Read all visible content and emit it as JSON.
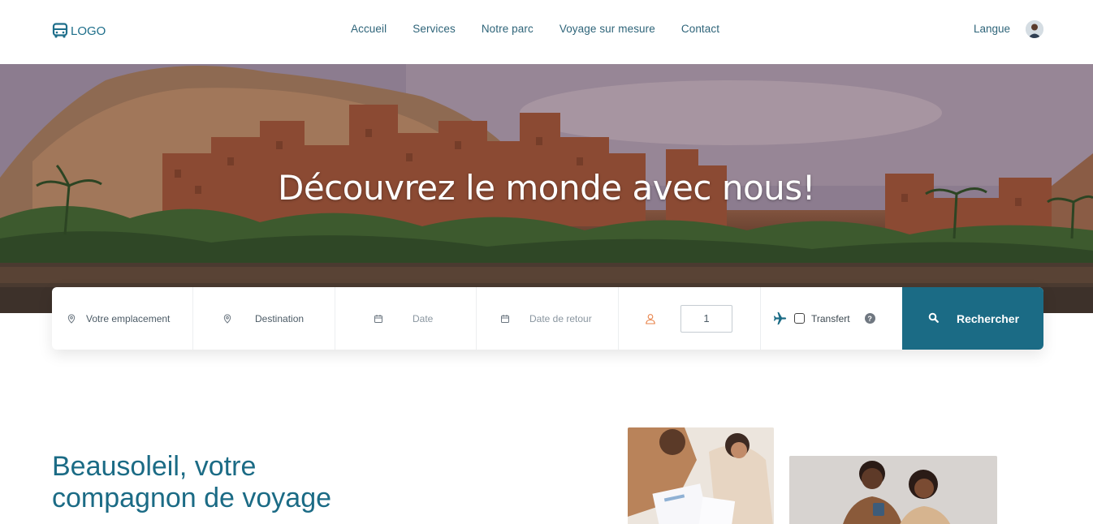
{
  "nav": {
    "logo_text": "LOGO",
    "logo_icon": "bus-icon",
    "links": [
      "Accueil",
      "Services",
      "Notre parc",
      "Voyage sur mesure",
      "Contact"
    ],
    "lang_label": "Langue"
  },
  "hero": {
    "title": "Découvrez le monde avec nous!"
  },
  "search": {
    "location_placeholder": "Votre emplacement",
    "destination_placeholder": "Destination",
    "date_placeholder": "Date",
    "return_date_placeholder": "Date de retour",
    "passengers_value": "1",
    "transfer_label": "Transfert",
    "help_symbol": "?",
    "submit_label": "Rechercher"
  },
  "about": {
    "title_line1": "Beausoleil, votre",
    "title_line2": "compagnon de voyage"
  },
  "colors": {
    "primary": "#1b6b85",
    "accent_orange": "#e8834a"
  }
}
